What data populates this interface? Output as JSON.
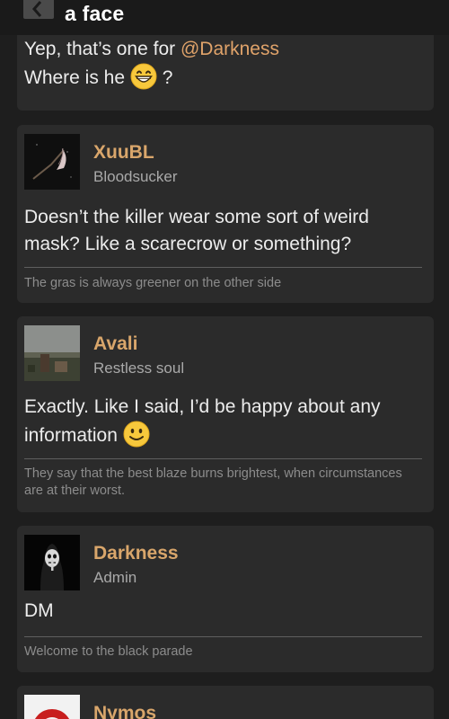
{
  "header": {
    "title": "a face"
  },
  "posts": [
    {
      "text_line1_prefix": "Yep, that’s one for ",
      "mention": "@Darkness",
      "text_line2_prefix": "Where is he ",
      "text_line2_emoji": "grinning-face-emoji",
      "text_line2_suffix": " ?"
    },
    {
      "username": "XuuBL",
      "rank": "Bloodsucker",
      "text": "Doesn’t the killer wear some sort of weird mask? Like a scarecrow or something?",
      "signature": "The gras is always greener on the other side"
    },
    {
      "username": "Avali",
      "rank": "Restless soul",
      "text": "Exactly. Like I said, I’d be happy about any information",
      "text_emoji": "slightly-smiling-face-emoji",
      "signature": "They say that the best blaze burns brightest, when circumstances are at their worst."
    },
    {
      "username": "Darkness",
      "rank": "Admin",
      "text": "DM",
      "signature": "Welcome to the black parade"
    },
    {
      "username": "Nymos"
    }
  ],
  "colors": {
    "background": "#1e1e1e",
    "card": "#2b2b2b",
    "username": "#d9a66b",
    "mention": "#e0a36a",
    "rank": "#a9a9a9",
    "signature": "#8c8c8c"
  }
}
